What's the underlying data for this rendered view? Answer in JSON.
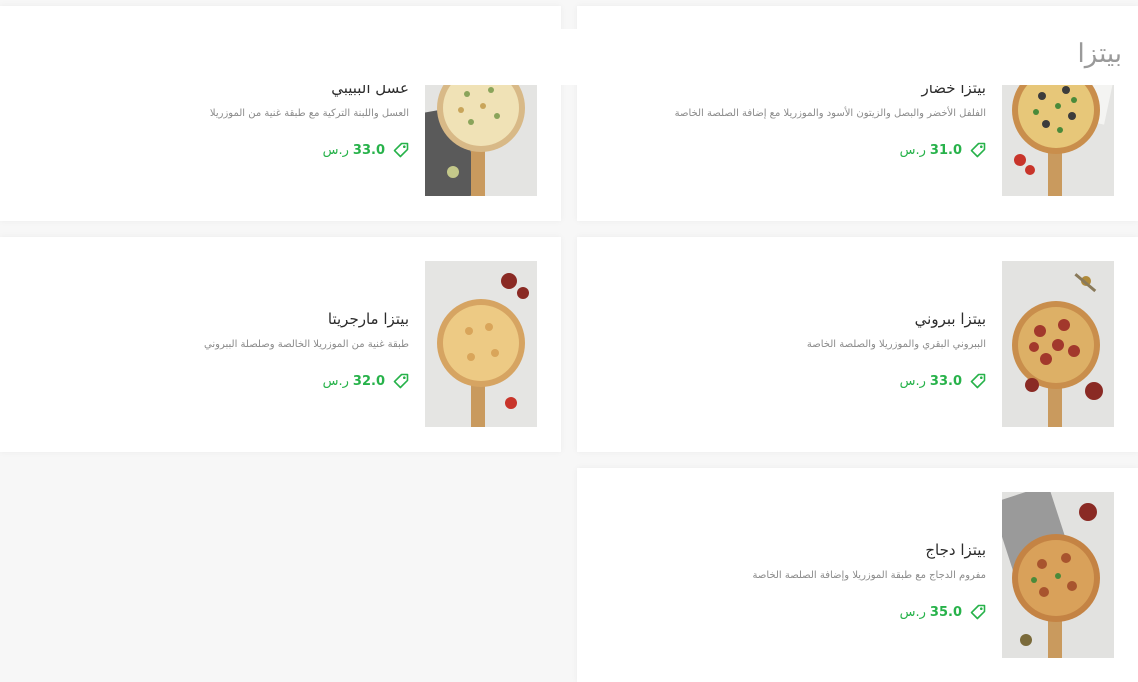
{
  "section": {
    "title": "بيتزا"
  },
  "colors": {
    "accent": "#27b24a",
    "title_gray": "#9a9a9a"
  },
  "items": [
    {
      "name": "بيتزا خضار",
      "description": "الفلفل الأخضر والبصل والزيتون الأسود والموزريلا مع إضافة الصلصة الخاصة",
      "price": "31.0",
      "currency": "ر.س",
      "icon": "tag-icon"
    },
    {
      "name": "بيتزا ببروني",
      "description": "الببروني البقري والموزريلا والصلصة الخاصة",
      "price": "33.0",
      "currency": "ر.س",
      "icon": "tag-icon"
    },
    {
      "name": "بيتزا دجاج",
      "description": "مفروم الدجاج مع طبقة الموزريلا وإضافة الصلصة الخاصة",
      "price": "35.0",
      "currency": "ر.س",
      "icon": "tag-icon"
    },
    {
      "name": "عسل الببيبي",
      "description": "العسل واللبنة التركية مع طبقة غنية من الموزريلا",
      "price": "33.0",
      "currency": "ر.س",
      "icon": "tag-icon"
    },
    {
      "name": "بيتزا مارجريتا",
      "description": "طبقة غنية من الموزريلا الخالصة وصلصلة الببروني",
      "price": "32.0",
      "currency": "ر.س",
      "icon": "tag-icon"
    }
  ]
}
